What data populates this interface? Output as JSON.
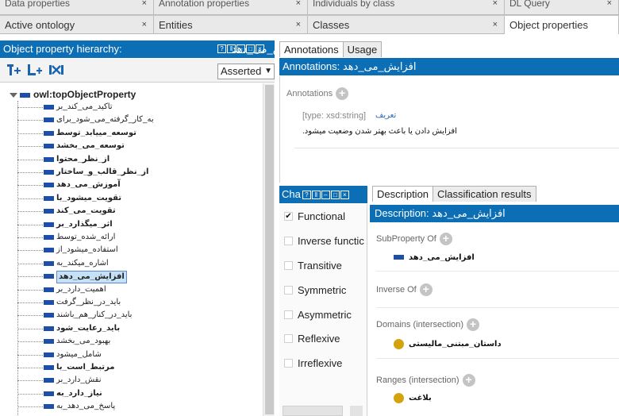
{
  "top_tabs_row1": [
    {
      "label": "Data properties"
    },
    {
      "label": "Annotation properties"
    },
    {
      "label": "Individuals by class"
    },
    {
      "label": "DL Query"
    }
  ],
  "top_tabs_row2": [
    {
      "label": "Active ontology"
    },
    {
      "label": "Entities"
    },
    {
      "label": "Classes"
    },
    {
      "label": "Object properties"
    }
  ],
  "close_glyph": "×",
  "left_panel": {
    "title": "Object property hierarchy:",
    "title_entity": "افزایش_می_دهد",
    "toolbar": {
      "add_sub_icon": "add-sub-property-icon",
      "add_sibling_icon": "add-sibling-property-icon",
      "delete_icon": "delete-property-icon",
      "mode": "Asserted"
    },
    "root": "owl:topObjectProperty",
    "items": [
      {
        "label": "تاکید_می_کند_بر",
        "bold": false
      },
      {
        "label": "به_کار_گرفته_می_شود_برای",
        "bold": false
      },
      {
        "label": "توسعه_مییابد_توسط",
        "bold": true
      },
      {
        "label": "توسعه_می_بخشد",
        "bold": true
      },
      {
        "label": "از_نظر_محتوا",
        "bold": true
      },
      {
        "label": "از_نظر_قالب_و_ساختار",
        "bold": true
      },
      {
        "label": "آموزش_می_دهد",
        "bold": true
      },
      {
        "label": "تقویت_میشود_با",
        "bold": true
      },
      {
        "label": "تقویت_می_کند",
        "bold": true
      },
      {
        "label": "اثر_میگذارد_بر",
        "bold": true
      },
      {
        "label": "ارائه_شده_توسط",
        "bold": false
      },
      {
        "label": "استفاده_میشود_از",
        "bold": false
      },
      {
        "label": "اشاره_میکند_به",
        "bold": false
      },
      {
        "label": "افزایش_می_دهد",
        "bold": true,
        "selected": true
      },
      {
        "label": "اهمیت_دارد_بر",
        "bold": false
      },
      {
        "label": "باید_در_نظر_گرفت",
        "bold": false
      },
      {
        "label": "باید_در_کنار_هم_باشند",
        "bold": false
      },
      {
        "label": "باید_رعایت_شود",
        "bold": true
      },
      {
        "label": "بهبود_می_بخشد",
        "bold": false
      },
      {
        "label": "شامل_میشود",
        "bold": false
      },
      {
        "label": "مرتبط_است_با",
        "bold": true
      },
      {
        "label": "نقش_دارد_بر",
        "bold": false
      },
      {
        "label": "نیاز_دارد_به",
        "bold": true
      },
      {
        "label": "پاسخ_می_دهد_به",
        "bold": false
      }
    ]
  },
  "annotations_panel": {
    "tabs": [
      "Annotations",
      "Usage"
    ],
    "title": "Annotations:",
    "title_entity": "افزایش_می_دهد",
    "section_label": "Annotations",
    "type": "[type: xsd:string]",
    "key": "تعریف",
    "value": "افزایش دادن یا باعث بهتر شدن وضعیت میشود."
  },
  "characteristics_panel": {
    "title": "Cha",
    "items": [
      {
        "label": "Functional",
        "checked": true,
        "mark": "✔"
      },
      {
        "label": "Inverse functic",
        "checked": false
      },
      {
        "label": "Transitive",
        "checked": false
      },
      {
        "label": "Symmetric",
        "checked": false
      },
      {
        "label": "Asymmetric",
        "checked": false
      },
      {
        "label": "Reflexive",
        "checked": false
      },
      {
        "label": "Irreflexive",
        "checked": false
      }
    ]
  },
  "description_panel": {
    "tabs": [
      "Description",
      "Classification results"
    ],
    "title": "Description:",
    "title_entity": "افزایش_می_دهد",
    "subproperty_label": "SubProperty Of",
    "subproperty_value": "افزایش_می_دهد",
    "inverse_label": "Inverse Of",
    "domains_label": "Domains (intersection)",
    "domains_value": "داستان_مبتنی_مالیستی",
    "ranges_label": "Ranges (intersection)",
    "ranges_value": "بلاغت"
  },
  "colors": {
    "title_blue": "#0c6fb5",
    "property_blue": "#1d4fa6",
    "class_gold": "#d4a20c"
  }
}
